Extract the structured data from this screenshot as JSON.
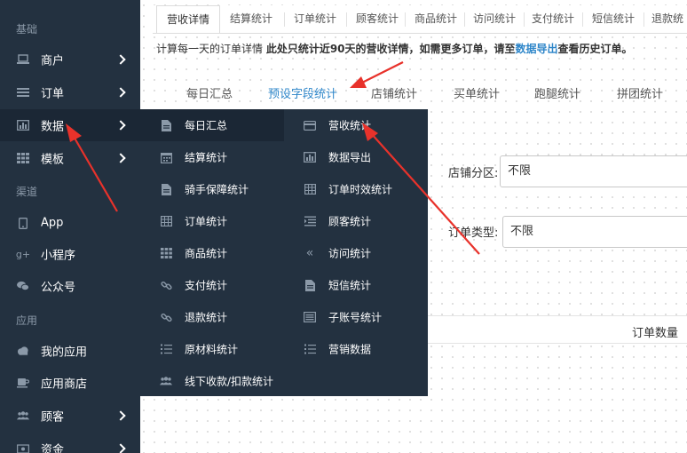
{
  "colors": {
    "sidebar_bg": "#233140",
    "flyout_bg": "#233140",
    "active_bg": "#1b2735",
    "link": "#2e86c9",
    "arrow": "#e8322b"
  },
  "sidebar": {
    "sections": [
      "基础",
      "渠道",
      "应用"
    ],
    "items": [
      {
        "label": "商户",
        "icon": "laptop-icon"
      },
      {
        "label": "订单",
        "icon": "list-icon"
      },
      {
        "label": "数据",
        "icon": "bar-chart-icon"
      },
      {
        "label": "模板",
        "icon": "grid-icon"
      },
      {
        "label": "App",
        "icon": "phone-icon"
      },
      {
        "label": "小程序",
        "icon": "google-plus-icon"
      },
      {
        "label": "公众号",
        "icon": "chat-icon"
      },
      {
        "label": "我的应用",
        "icon": "cloud-icon"
      },
      {
        "label": "应用商店",
        "icon": "cup-icon"
      },
      {
        "label": "顾客",
        "icon": "users-icon"
      },
      {
        "label": "资金",
        "icon": "money-icon"
      }
    ]
  },
  "top_tabs": [
    "营收详情",
    "结算统计",
    "订单统计",
    "顾客统计",
    "商品统计",
    "访问统计",
    "支付统计",
    "短信统计",
    "退款统"
  ],
  "notice": {
    "prefix": "计算每一天的订单详情 ",
    "bold": "此处只统计近90天的营收详情，如需更多订单，请至",
    "link": "数据导出",
    "suffix": "查看历史订单。"
  },
  "sub_tabs": [
    "每日汇总",
    "预设字段统计",
    "店铺统计",
    "买单统计",
    "跑腿统计",
    "拼团统计"
  ],
  "filters": {
    "shop_region_label": "店铺分区:",
    "shop_region_value": "不限",
    "order_type_label": "订单类型:",
    "order_type_value": "不限"
  },
  "table": {
    "order_count_header": "订单数量"
  },
  "flyout": {
    "left": [
      {
        "label": "每日汇总",
        "icon": "file-icon"
      },
      {
        "label": "结算统计",
        "icon": "calendar-icon"
      },
      {
        "label": "骑手保障统计",
        "icon": "file-icon"
      },
      {
        "label": "订单统计",
        "icon": "table-icon"
      },
      {
        "label": "商品统计",
        "icon": "grid-icon"
      },
      {
        "label": "支付统计",
        "icon": "link-icon"
      },
      {
        "label": "退款统计",
        "icon": "link-icon"
      },
      {
        "label": "原材料统计",
        "icon": "list-ordered-icon"
      },
      {
        "label": "线下收款/扣款统计",
        "icon": "users-icon"
      }
    ],
    "right": [
      {
        "label": "营收统计",
        "icon": "credit-card-icon"
      },
      {
        "label": "数据导出",
        "icon": "bar-chart-icon"
      },
      {
        "label": "订单时效统计",
        "icon": "table-icon"
      },
      {
        "label": "顾客统计",
        "icon": "indent-icon"
      },
      {
        "label": "访问统计",
        "icon": "double-angle-left-icon"
      },
      {
        "label": "短信统计",
        "icon": "file-icon"
      },
      {
        "label": "子账号统计",
        "icon": "newspaper-icon"
      },
      {
        "label": "营销数据",
        "icon": "list-ordered-icon"
      }
    ]
  }
}
